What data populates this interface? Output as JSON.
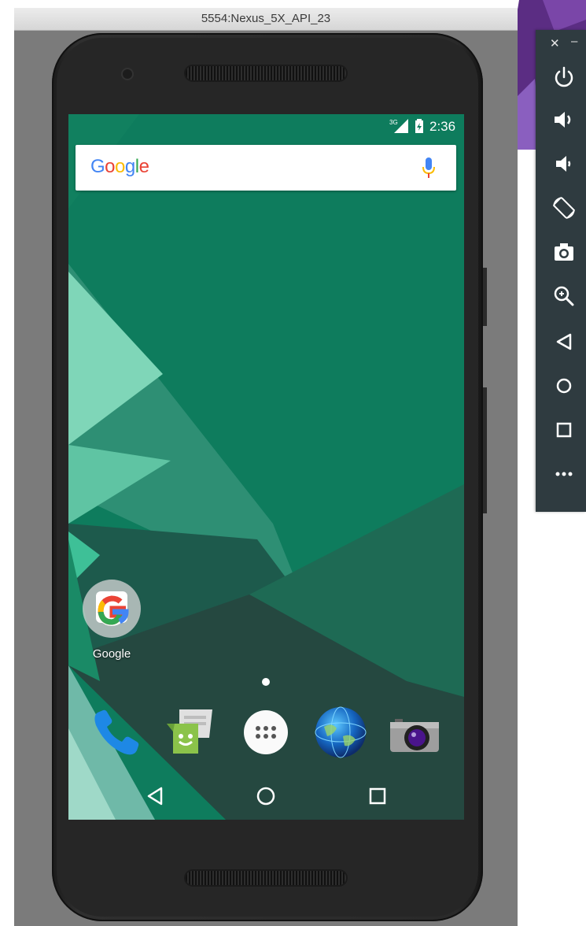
{
  "window": {
    "title": "5554:Nexus_5X_API_23"
  },
  "status_bar": {
    "network": "3G",
    "time": "2:36"
  },
  "search_widget": {
    "logo_text": "Google",
    "logo_colors": [
      "#4285F4",
      "#EA4335",
      "#FBBC05",
      "#4285F4",
      "#34A853",
      "#EA4335"
    ]
  },
  "home_apps": [
    {
      "label": "Google",
      "icon": "google-icon"
    }
  ],
  "dock": [
    {
      "icon": "phone-icon"
    },
    {
      "icon": "messenger-icon"
    },
    {
      "icon": "app-drawer-icon"
    },
    {
      "icon": "browser-globe-icon"
    },
    {
      "icon": "camera-icon"
    }
  ],
  "nav_buttons": [
    "back",
    "home",
    "recents"
  ],
  "toolbar": {
    "close_glyph": "✕",
    "minimize_glyph": "–",
    "buttons": [
      "power",
      "volume-up",
      "volume-down",
      "rotate",
      "screenshot",
      "zoom",
      "back",
      "home",
      "overview",
      "more"
    ]
  },
  "colors": {
    "wallpaper_green": "#0f7a5c",
    "toolbar_bg": "#2f3b40",
    "window_bg": "#7b7b7b"
  }
}
